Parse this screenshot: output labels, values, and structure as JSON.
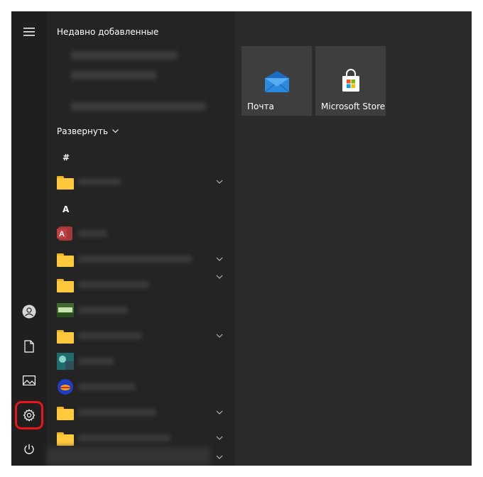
{
  "recent": {
    "title": "Недавно добавленные"
  },
  "expand": {
    "label": "Развернуть"
  },
  "groups": [
    {
      "letter": "#"
    },
    {
      "letter": "A"
    }
  ],
  "tiles": [
    {
      "label": "Почта",
      "icon": "mail-icon"
    },
    {
      "label": "Microsoft Store",
      "icon": "store-icon"
    }
  ],
  "rail": {
    "items": [
      "hamburger-icon",
      "user-icon",
      "document-icon",
      "pictures-icon",
      "gear-icon",
      "power-icon"
    ],
    "highlight_color": "#e8151c"
  },
  "app_icons": [
    "folder-icon",
    "access-icon",
    "folder-icon",
    "folder-icon",
    "game-icon",
    "folder-icon",
    "app-icon",
    "globe-icon",
    "folder-icon",
    "folder-icon"
  ]
}
